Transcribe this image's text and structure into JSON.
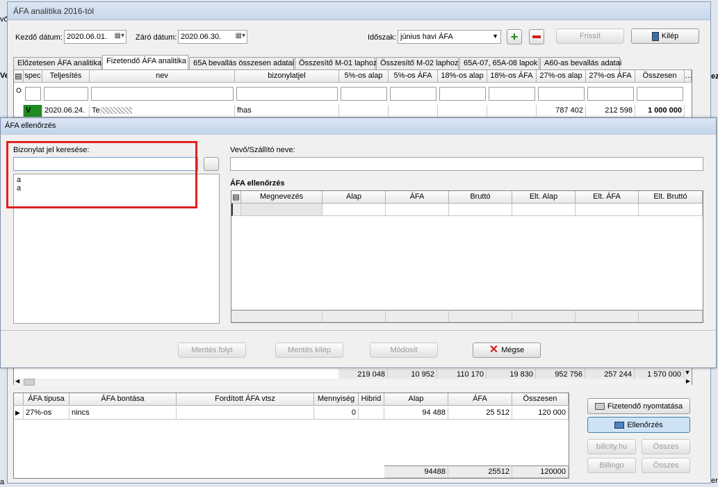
{
  "window": {
    "title": "ÁFA analitika 2016-tól"
  },
  "toolbar": {
    "start_label": "Kezdő dátum:",
    "start_value": "2020.06.01.",
    "end_label": "Záró dátum:",
    "end_value": "2020.06.30.",
    "period_label": "Időszak:",
    "period_value": "június havi ÁFA",
    "refresh_label": "Frissít",
    "exit_label": "Kilép"
  },
  "tabs": [
    "Előzetesen ÁFA analitika",
    "Fizetendő ÁFA analitika",
    "65A bevallás összesen adatai",
    "Összesítő M-01 laphoz",
    "Összesítő M-02 laphoz",
    "65A-07, 65A-08 lapok",
    "A60-as bevallás adatai"
  ],
  "main_grid": {
    "headers": [
      "spec",
      "Teljesítés",
      "nev",
      "bizonylatjel",
      "5%-os alap",
      "5%-os ÁFA",
      "18%-os alap",
      "18%-os ÁFA",
      "27%-os alap",
      "27%-os ÁFA",
      "Összesen"
    ],
    "row": {
      "spec": "V",
      "date": "2020.06.24.",
      "name": "Te",
      "doc": "fhas",
      "alap27": "787 402",
      "afa27": "212 598",
      "total": "1 000 000"
    },
    "totals": [
      "219 048",
      "10 952",
      "110 170",
      "19 830",
      "952 756",
      "257 244",
      "1 570 000"
    ]
  },
  "left_labels": {
    "vo": "vő",
    "ve": "Ve",
    "a": "a"
  },
  "right_labels": {
    "erz": "erz",
    "ez": "ez"
  },
  "dialog": {
    "title": "ÁFA ellenőrzés",
    "search_label": "Bizonylat jel keresése:",
    "list_items": [
      "a",
      "a"
    ],
    "vendor_label": "Vevő/Szállító neve:",
    "check_title": "ÁFA ellenőrzés",
    "check_headers": [
      "Megnevezés",
      "Alap",
      "ÁFA",
      "Bruttó",
      "Elt. Alap",
      "Elt. ÁFA",
      "Elt. Bruttó"
    ],
    "buttons": {
      "save_continue": "Mentés folyt",
      "save_exit": "Mentés kilép",
      "modify": "Módosít",
      "cancel": "Mégse"
    }
  },
  "bottom_grid": {
    "headers": [
      "ÁFA tipusa",
      "ÁFA bontása",
      "Fordított ÁFA vtsz",
      "Mennyiség",
      "Hibrid",
      "Alap",
      "ÁFA",
      "Összesen"
    ],
    "row": {
      "type": "27%-os",
      "split": "nincs",
      "qty": "0",
      "alap": "94 488",
      "afa": "25 512",
      "total": "120 000"
    },
    "totals": {
      "alap": "94488",
      "afa": "25512",
      "total": "120000"
    }
  },
  "side_buttons": {
    "print": "Fizetendő nyomtatása",
    "check": "Ellenőrzés",
    "billcity": "billcity.hu",
    "billingo": "Billingo",
    "all1": "Összes",
    "all2": "Összes"
  },
  "colors": {
    "accent_green": "#1e8b1e",
    "highlight_red": "#e02020",
    "active_blue": "#cfe3f7"
  }
}
